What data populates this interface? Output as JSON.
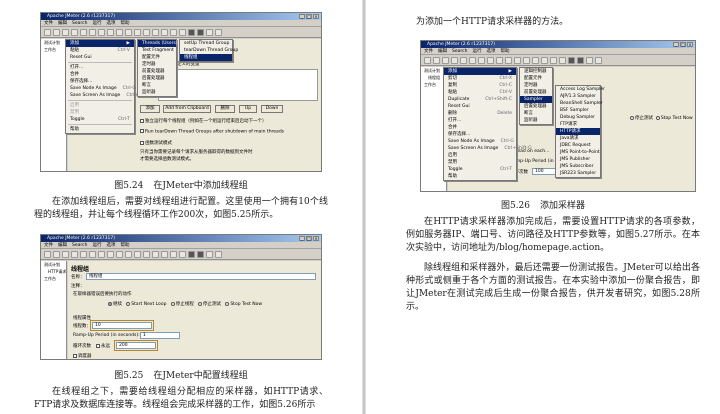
{
  "left_page": {
    "fig24": {
      "number": "图5.24",
      "title": "在JMeter中添加线程组",
      "window_title": "Apache JMeter (2.6 r1237317)",
      "menubar": [
        "文件",
        "编辑",
        "Search",
        "运行",
        "选项",
        "帮助"
      ],
      "tree_items": [
        "测试计划",
        "工作台"
      ],
      "edit_menu": [
        {
          "label": "添加",
          "shortcut": "",
          "selected": true
        },
        {
          "label": "粘贴",
          "shortcut": "Ctrl-V"
        },
        {
          "label": "Reset Gui",
          "shortcut": ""
        },
        {
          "label": "打开...",
          "shortcut": ""
        },
        {
          "label": "合并",
          "shortcut": ""
        },
        {
          "label": "保存选择...",
          "shortcut": ""
        },
        {
          "label": "Save Node As Image",
          "shortcut": "Ctrl-G"
        },
        {
          "label": "Save Screen As Image",
          "shortcut": "Ctrl+Shift-G"
        },
        {
          "label": "启用",
          "shortcut": "",
          "disabled": true
        },
        {
          "label": "禁用",
          "shortcut": "",
          "disabled": true
        },
        {
          "label": "Toggle",
          "shortcut": "Ctrl-T"
        },
        {
          "label": "帮助",
          "shortcut": ""
        }
      ],
      "add_menu": [
        {
          "label": "Threads (Users)",
          "selected": true
        },
        {
          "label": "Test Fragment"
        },
        {
          "label": "配置元件"
        },
        {
          "label": "定时器"
        },
        {
          "label": "前置处理器"
        },
        {
          "label": "后置处理器"
        },
        {
          "label": "断言"
        },
        {
          "label": "监听器"
        }
      ],
      "threads_menu": [
        {
          "label": "setUp Thread Group"
        },
        {
          "label": "tearDown Thread Group"
        },
        {
          "label": "线程组",
          "selected": true
        }
      ],
      "user_vars_label": "用户定义的变量",
      "buttons": [
        "添加",
        "Add from Clipboard",
        "删除",
        "Up",
        "Down"
      ],
      "bottom_text_1": "独立运行每个线程组（例如在一个组运行结束后启动下一个）",
      "bottom_text_2": "Run tearDown Thread Groups after shutdown of main threads",
      "bottom_text_3": "函数测试模式",
      "bottom_text_4": "只有当你需要记录每个请求从服务器取得的数据到文件时",
      "bottom_text_5": "才需要选择函数测试模式。"
    },
    "para1": "在添加线程组后，需要对线程组进行配置。这里使用一个拥有10个线程的线程组，并让每个线程循环工作200次，如图5.25所示。",
    "fig25": {
      "number": "图5.25",
      "title": "在JMeter中配置线程组",
      "window_title": "Apache JMeter (2.6 r1237317)",
      "menubar": [
        "文件",
        "编辑",
        "Search",
        "运行",
        "选项",
        "帮助"
      ],
      "tree_items": [
        "测试计划",
        "HTTP请求",
        "工作台"
      ],
      "panel_title": "线程组",
      "name_label": "名称：",
      "name_value": "线程组",
      "comment_label": "注释：",
      "error_label": "在取样器错误后要执行的动作",
      "error_options": [
        "继续",
        "Start Next Loop",
        "停止线程",
        "停止测试",
        "Stop Test Now"
      ],
      "props_label": "线程属性",
      "threads_label": "线程数：",
      "threads_value": "10",
      "rampup_label": "Ramp-Up Period (in seconds):",
      "rampup_value": "1",
      "loop_label": "循环次数",
      "loop_forever": "永远",
      "loop_value": "200",
      "scheduler_label": "调度器"
    },
    "para2": "在线程组之下，需要给线程组分配相应的采样器，如HTTP请求、FTP请求及数据库连接等。线程组会完成采样器的工作，如图5.26所示"
  },
  "right_page": {
    "para0": "为添加一个HTTP请求采样器的方法。",
    "fig26": {
      "number": "图5.26",
      "title": "添加采样器",
      "window_title": "Apache JMeter (2.6 r1237317)",
      "menubar": [
        "文件",
        "编辑",
        "Search",
        "运行",
        "选项",
        "帮助"
      ],
      "tree_items": [
        "测试计划",
        "线程组",
        "工作台"
      ],
      "edit_menu": [
        {
          "label": "添加",
          "selected": true
        },
        {
          "label": "剪切",
          "shortcut": "Ctrl-X"
        },
        {
          "label": "复制",
          "shortcut": "Ctrl-C"
        },
        {
          "label": "粘贴",
          "shortcut": "Ctrl-V"
        },
        {
          "label": "Duplicate",
          "shortcut": "Ctrl+Shift-C"
        },
        {
          "label": "Reset Gui"
        },
        {
          "label": "删除",
          "shortcut": "Delete"
        },
        {
          "label": "打开..."
        },
        {
          "label": "合并"
        },
        {
          "label": "保存选择..."
        },
        {
          "label": "Save Node As Image",
          "shortcut": "Ctrl-G"
        },
        {
          "label": "Save Screen As Image",
          "shortcut": "Ctrl+Shift-G"
        },
        {
          "label": "启用"
        },
        {
          "label": "禁用"
        },
        {
          "label": "Toggle",
          "shortcut": "Ctrl-T"
        },
        {
          "label": "帮助"
        }
      ],
      "add_menu": [
        {
          "label": "逻辑控制器"
        },
        {
          "label": "配置元件"
        },
        {
          "label": "定时器"
        },
        {
          "label": "前置处理器"
        },
        {
          "label": "Sampler",
          "selected": true
        },
        {
          "label": "后置处理器"
        },
        {
          "label": "断言"
        },
        {
          "label": "监听器"
        }
      ],
      "sampler_menu": [
        {
          "label": "Access Log Sampler"
        },
        {
          "label": "AJP/1.3 Sampler"
        },
        {
          "label": "BeanShell Sampler"
        },
        {
          "label": "BSF Sampler"
        },
        {
          "label": "Debug Sampler"
        },
        {
          "label": "FTP请求"
        },
        {
          "label": "HTTP请求",
          "selected": true
        },
        {
          "label": "Java请求"
        },
        {
          "label": "JDBC Request"
        },
        {
          "label": "JMS Point-to-Point"
        },
        {
          "label": "JMS Publisher"
        },
        {
          "label": "JMS Subscriber"
        },
        {
          "label": "JSR223 Sampler"
        }
      ],
      "panel_options": [
        "停止测试",
        "Stop Test Now"
      ],
      "panel_label_1": "Thread on each...",
      "panel_label_2": "Ramp-Up Period (in seconds):",
      "loop_label": "循环次数",
      "loop_value": "100"
    },
    "para1": "在HTTP请求采样器添加完成后，需要设置HTTP请求的各项参数，例如服务器IP、端口号、访问路径及HTTP参数等，如图5.27所示。在本次实验中，访问地址为/blog/homepage.action。",
    "para2": "除线程组和采样器外，最后还需要一份测试报告。JMeter可以给出各种形式或侧重于各个方面的测试报告。在本实验中添加一份聚合报告，即让JMeter在测试完成后生成一份聚合报告，供开发者研究，如图5.28所示。"
  }
}
